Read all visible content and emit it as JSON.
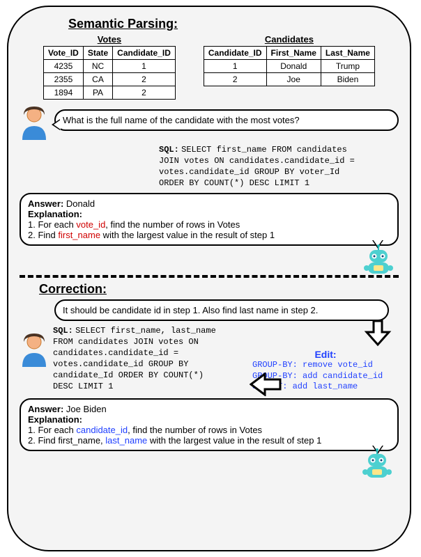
{
  "sections": {
    "semantic_parsing_title": "Semantic Parsing:",
    "correction_title": "Correction:"
  },
  "tables": {
    "votes": {
      "title": "Votes",
      "headers": [
        "Vote_ID",
        "State",
        "Candidate_ID"
      ],
      "rows": [
        [
          "4235",
          "NC",
          "1"
        ],
        [
          "2355",
          "CA",
          "2"
        ],
        [
          "1894",
          "PA",
          "2"
        ]
      ]
    },
    "candidates": {
      "title": "Candidates",
      "headers": [
        "Candidate_ID",
        "First_Name",
        "Last_Name"
      ],
      "rows": [
        [
          "1",
          "Donald",
          "Trump"
        ],
        [
          "2",
          "Joe",
          "Biden"
        ]
      ]
    }
  },
  "user_question": "What is the full name of the candidate with the most votes?",
  "sql_label": "SQL:",
  "sql1": "SELECT first_name FROM candidates\nJOIN votes ON candidates.candidate_id =\nvotes.candidate_id GROUP BY voter_Id\nORDER BY COUNT(*) DESC LIMIT 1",
  "answer_label": "Answer:",
  "explanation_label": "Explanation:",
  "answer1": "Donald",
  "exp1_line1_pre": "1. For each ",
  "exp1_line1_red": "vote_id",
  "exp1_line1_post": ", find the number of rows in Votes",
  "exp1_line2_pre": "2. Find ",
  "exp1_line2_red": "first_name",
  "exp1_line2_post": " with the largest value in the result of step 1",
  "correction_text": "It should be candidate id in step 1. Also find last name in step 2.",
  "sql2": "SELECT first_name, last_name\nFROM candidates JOIN votes ON\ncandidates.candidate_id =\nvotes.candidate_id GROUP BY\ncandidate_Id ORDER BY COUNT(*)\nDESC LIMIT 1",
  "edit_label": "Edit:",
  "edit_lines": [
    "GROUP-BY: remove vote_id",
    "GROUP-BY: add candidate_id",
    "SELECT: add last_name"
  ],
  "answer2": "Joe Biden",
  "exp2_line1_pre": "1. For each ",
  "exp2_line1_blue": "candidate_id",
  "exp2_line1_post": ", find the number of rows in Votes",
  "exp2_line2_pre": "2. Find first_name, ",
  "exp2_line2_blue": "last_name",
  "exp2_line2_post": " with the largest value in the result of step 1"
}
